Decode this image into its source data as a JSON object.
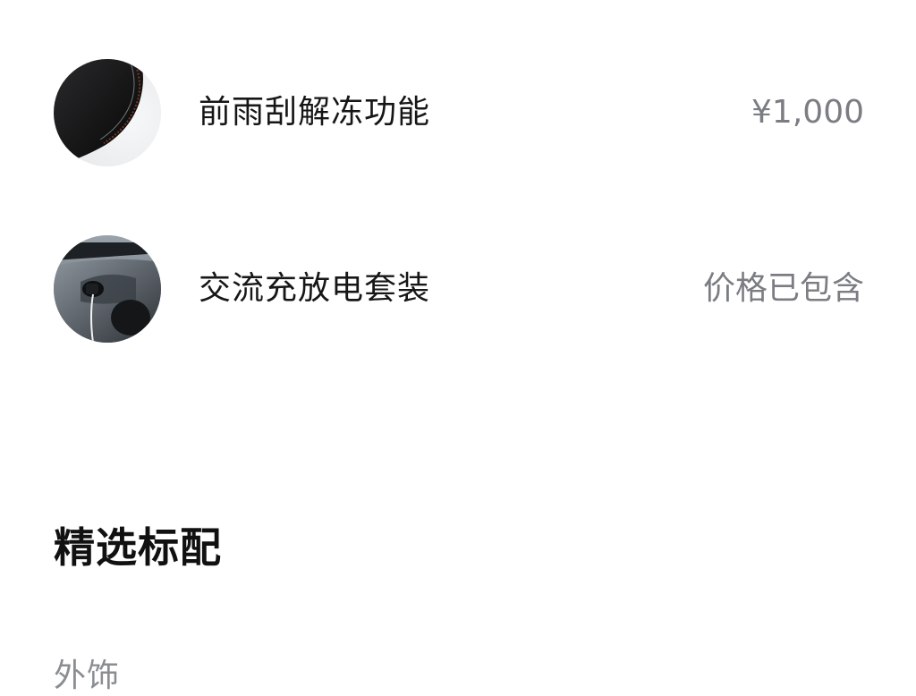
{
  "options": [
    {
      "name": "前雨刮解冻功能",
      "price": "¥1,000",
      "icon": "wiper-defrost-thumbnail-icon"
    },
    {
      "name": "交流充放电套装",
      "price": "价格已包含",
      "icon": "ac-charging-thumbnail-icon"
    }
  ],
  "section": {
    "title": "精选标配",
    "category": "外饰"
  },
  "colors": {
    "text_primary": "#161616",
    "text_secondary": "#7a7d82",
    "background": "#ffffff"
  }
}
